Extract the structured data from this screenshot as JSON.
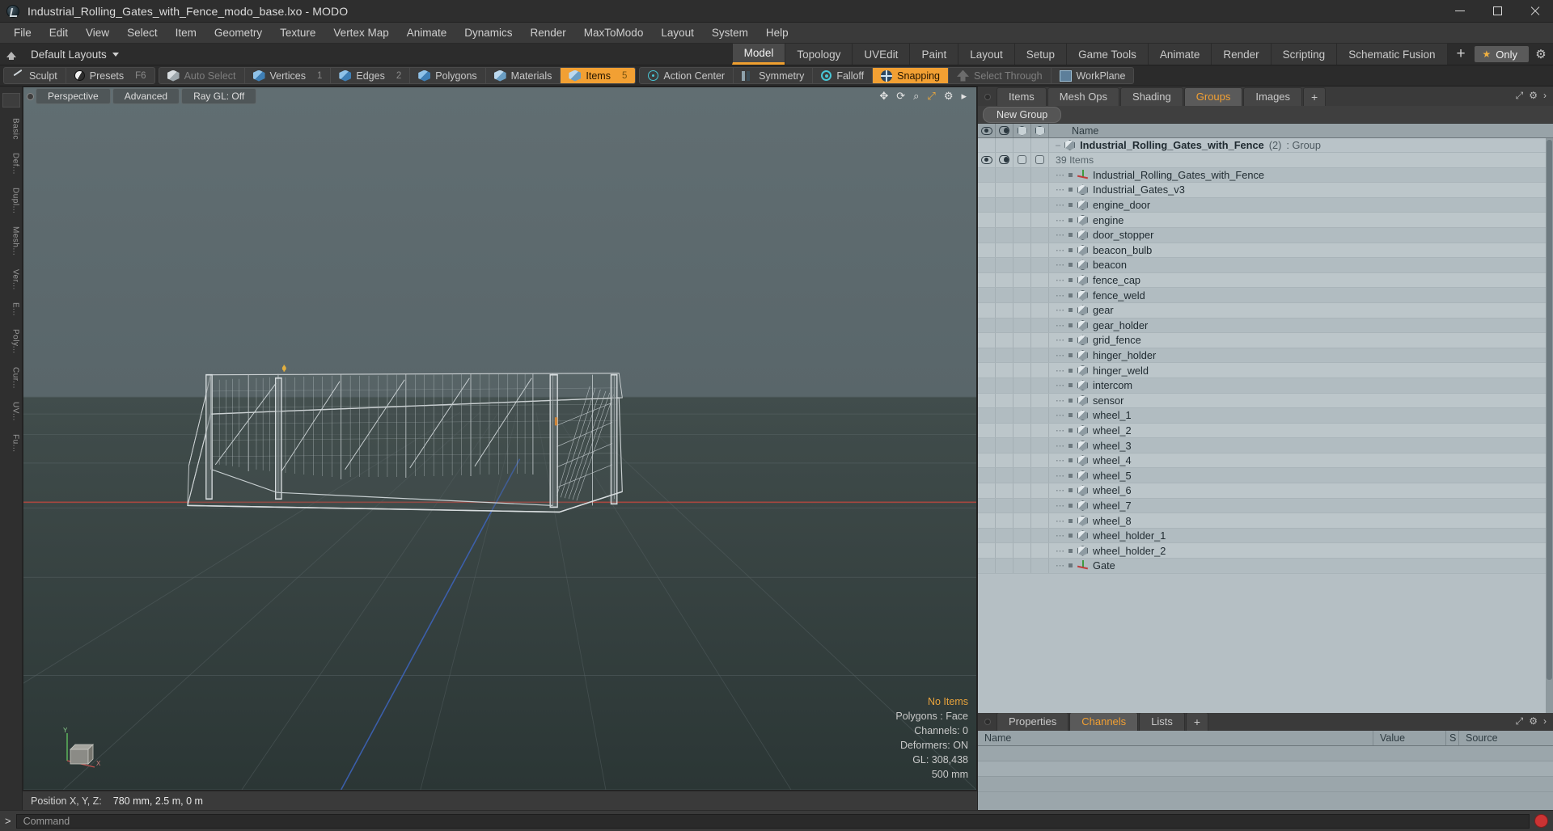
{
  "window": {
    "title": "Industrial_Rolling_Gates_with_Fence_modo_base.lxo - MODO",
    "app_icon": "modo-app-icon",
    "minimize": "–",
    "maximize": "□",
    "close": "✕"
  },
  "menubar": {
    "items": [
      "File",
      "Edit",
      "View",
      "Select",
      "Item",
      "Geometry",
      "Texture",
      "Vertex Map",
      "Animate",
      "Dynamics",
      "Render",
      "MaxToModo",
      "Layout",
      "System",
      "Help"
    ]
  },
  "layoutbar": {
    "layout_selector": "Default Layouts",
    "tabs": [
      {
        "label": "Model",
        "active": true
      },
      {
        "label": "Topology",
        "active": false
      },
      {
        "label": "UVEdit",
        "active": false
      },
      {
        "label": "Paint",
        "active": false
      },
      {
        "label": "Layout",
        "active": false
      },
      {
        "label": "Setup",
        "active": false
      },
      {
        "label": "Game Tools",
        "active": false
      },
      {
        "label": "Animate",
        "active": false
      },
      {
        "label": "Render",
        "active": false
      },
      {
        "label": "Scripting",
        "active": false
      },
      {
        "label": "Schematic Fusion",
        "active": false
      }
    ],
    "add_tab": "+",
    "only_button": "Only",
    "only_star": "★",
    "gear": "⚙"
  },
  "modebar": {
    "groups": [
      {
        "buttons": [
          {
            "label": "Sculpt",
            "icon": "sculpt-icon",
            "key": "",
            "state": "normal"
          },
          {
            "label": "Presets",
            "icon": "presets-icon",
            "key": "F6",
            "state": "normal"
          }
        ]
      },
      {
        "buttons": [
          {
            "label": "Auto Select",
            "icon": "auto-select-icon",
            "key": "",
            "state": "dim"
          },
          {
            "label": "Vertices",
            "icon": "vertices-icon",
            "key": "1",
            "state": "normal"
          },
          {
            "label": "Edges",
            "icon": "edges-icon",
            "key": "2",
            "state": "normal"
          },
          {
            "label": "Polygons",
            "icon": "polygons-icon",
            "key": "",
            "state": "normal"
          },
          {
            "label": "Materials",
            "icon": "materials-icon",
            "key": "",
            "state": "normal"
          },
          {
            "label": "Items",
            "icon": "items-icon",
            "key": "5",
            "state": "on"
          }
        ]
      },
      {
        "buttons": [
          {
            "label": "Action Center",
            "icon": "action-center-icon",
            "key": "",
            "state": "normal"
          },
          {
            "label": "Symmetry",
            "icon": "symmetry-icon",
            "key": "",
            "state": "normal"
          },
          {
            "label": "Falloff",
            "icon": "falloff-icon",
            "key": "",
            "state": "normal"
          },
          {
            "label": "Snapping",
            "icon": "snapping-icon",
            "key": "",
            "state": "on"
          },
          {
            "label": "Select Through",
            "icon": "select-through-icon",
            "key": "",
            "state": "dim"
          },
          {
            "label": "WorkPlane",
            "icon": "workplane-icon",
            "key": "",
            "state": "normal"
          }
        ]
      }
    ]
  },
  "leftstrip": {
    "items": [
      "Basic",
      "Def...",
      "Dupl...",
      "Mesh...",
      "Ver...",
      "E...",
      "Poly...",
      "Cur...",
      "UV...",
      "Fu..."
    ]
  },
  "viewport": {
    "tabs": [
      "Perspective",
      "Advanced",
      "Ray GL: Off"
    ],
    "tools": [
      "move-icon",
      "rotate-icon",
      "zoom-icon",
      "fit-icon",
      "gear-icon",
      "arrow-icon"
    ],
    "stats": {
      "selection": "No Items",
      "polygons": "Polygons : Face",
      "channels": "Channels: 0",
      "deformers": "Deformers: ON",
      "gl": "GL: 308,438",
      "scale": "500 mm"
    },
    "gizmo": {
      "y": "Y",
      "x": "X"
    }
  },
  "statusbar": {
    "label": "Position X, Y, Z:",
    "value": "780 mm, 2.5 m, 0 m"
  },
  "rightpanel": {
    "tabs": [
      {
        "label": "Items",
        "active": false
      },
      {
        "label": "Mesh Ops",
        "active": false
      },
      {
        "label": "Shading",
        "active": false
      },
      {
        "label": "Groups",
        "active": true
      },
      {
        "label": "Images",
        "active": false
      },
      {
        "label": "+",
        "active": false
      }
    ],
    "new_group_button": "New Group",
    "tree_header": {
      "columns": [
        "eye-icon",
        "half-eye-icon",
        "cube-outline-icon",
        "cube-solid-icon"
      ],
      "name": "Name"
    },
    "group": {
      "name": "Industrial_Rolling_Gates_with_Fence",
      "count": "(2)",
      "type": ": Group",
      "item_count": "39 Items"
    },
    "items": [
      {
        "name": "Industrial_Rolling_Gates_with_Fence",
        "icon": "locator-icon"
      },
      {
        "name": "Industrial_Gates_v3",
        "icon": "mesh-icon"
      },
      {
        "name": "engine_door",
        "icon": "mesh-icon"
      },
      {
        "name": "engine",
        "icon": "mesh-icon"
      },
      {
        "name": "door_stopper",
        "icon": "mesh-icon"
      },
      {
        "name": "beacon_bulb",
        "icon": "mesh-icon"
      },
      {
        "name": "beacon",
        "icon": "mesh-icon"
      },
      {
        "name": "fence_cap",
        "icon": "mesh-icon"
      },
      {
        "name": "fence_weld",
        "icon": "mesh-icon"
      },
      {
        "name": "gear",
        "icon": "mesh-icon"
      },
      {
        "name": "gear_holder",
        "icon": "mesh-icon"
      },
      {
        "name": "grid_fence",
        "icon": "mesh-icon"
      },
      {
        "name": "hinger_holder",
        "icon": "mesh-icon"
      },
      {
        "name": "hinger_weld",
        "icon": "mesh-icon"
      },
      {
        "name": "intercom",
        "icon": "mesh-icon"
      },
      {
        "name": "sensor",
        "icon": "mesh-icon"
      },
      {
        "name": "wheel_1",
        "icon": "mesh-icon"
      },
      {
        "name": "wheel_2",
        "icon": "mesh-icon"
      },
      {
        "name": "wheel_3",
        "icon": "mesh-icon"
      },
      {
        "name": "wheel_4",
        "icon": "mesh-icon"
      },
      {
        "name": "wheel_5",
        "icon": "mesh-icon"
      },
      {
        "name": "wheel_6",
        "icon": "mesh-icon"
      },
      {
        "name": "wheel_7",
        "icon": "mesh-icon"
      },
      {
        "name": "wheel_8",
        "icon": "mesh-icon"
      },
      {
        "name": "wheel_holder_1",
        "icon": "mesh-icon"
      },
      {
        "name": "wheel_holder_2",
        "icon": "mesh-icon"
      },
      {
        "name": "Gate",
        "icon": "locator-icon"
      }
    ]
  },
  "bottompanel": {
    "tabs": [
      {
        "label": "Properties",
        "active": false
      },
      {
        "label": "Channels",
        "active": true
      },
      {
        "label": "Lists",
        "active": false
      },
      {
        "label": "+",
        "active": false
      }
    ],
    "columns": [
      "Name",
      "Value",
      "S",
      "Source"
    ]
  },
  "commandbar": {
    "caret": ">",
    "placeholder": "Command",
    "record_icon": "record-icon"
  }
}
